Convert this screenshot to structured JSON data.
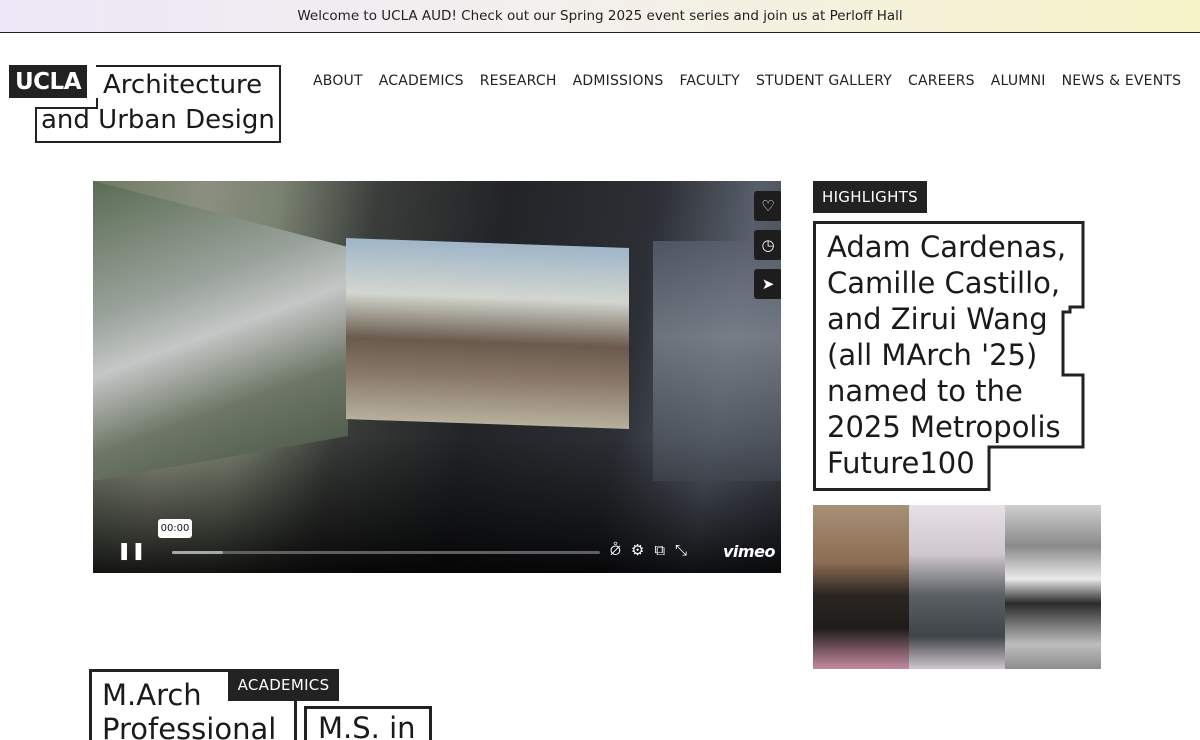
{
  "announcement": "Welcome to UCLA AUD! Check out our Spring 2025 event series and join us at Perloff Hall",
  "logo": {
    "badge": "UCLA",
    "line1": "Architecture",
    "line2": "and Urban Design"
  },
  "nav": {
    "items": [
      "ABOUT",
      "ACADEMICS",
      "RESEARCH",
      "ADMISSIONS",
      "FACULTY",
      "STUDENT GALLERY",
      "CAREERS",
      "ALUMNI",
      "NEWS & EVENTS"
    ]
  },
  "video": {
    "time": "00:00",
    "progress": 0.12,
    "brand": "vimeo",
    "side_icons": [
      "heart-icon",
      "clock-icon",
      "send-icon"
    ],
    "control_icons": [
      "pause-icon",
      "captions-off-icon",
      "gear-icon",
      "pip-icon",
      "fullscreen-icon"
    ]
  },
  "highlights": {
    "tag": "HIGHLIGHTS",
    "headline": "Adam Cardenas, Camille Castillo, and Zirui Wang (all MArch '25) named to the 2025 Metropolis Future100"
  },
  "academics": {
    "tag": "ACADEMICS",
    "card1": "M.Arch Professional",
    "card2": "M.S. in"
  }
}
